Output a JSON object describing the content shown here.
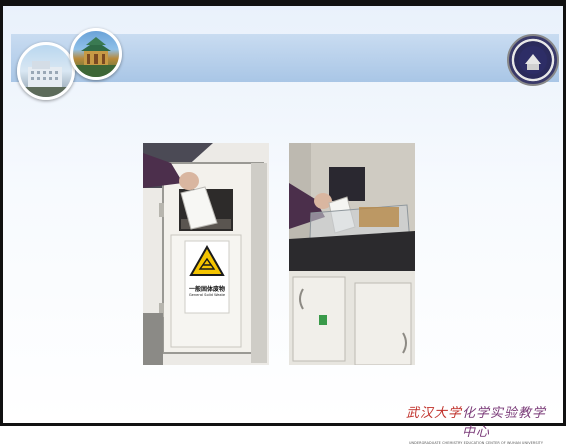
{
  "sign": {
    "title_cn": "一般固体废物",
    "title_en": "General Solid Waste"
  },
  "footer": {
    "brand_cn_school": "武汉大学",
    "brand_cn_center": "化学实验教学中心",
    "brand_en": "UNDERGRADUATE CHEMISTRY EDUCATION CENTER OF WUHAN UNIVERSITY"
  },
  "colors": {
    "header_band": "#a9c6e6",
    "brand_purple": "#7a3a78",
    "brand_red": "#c0302a"
  },
  "icons": [
    "campus-building-logo",
    "pavilion-logo",
    "university-emblem-icon",
    "warning-triangle-icon"
  ]
}
